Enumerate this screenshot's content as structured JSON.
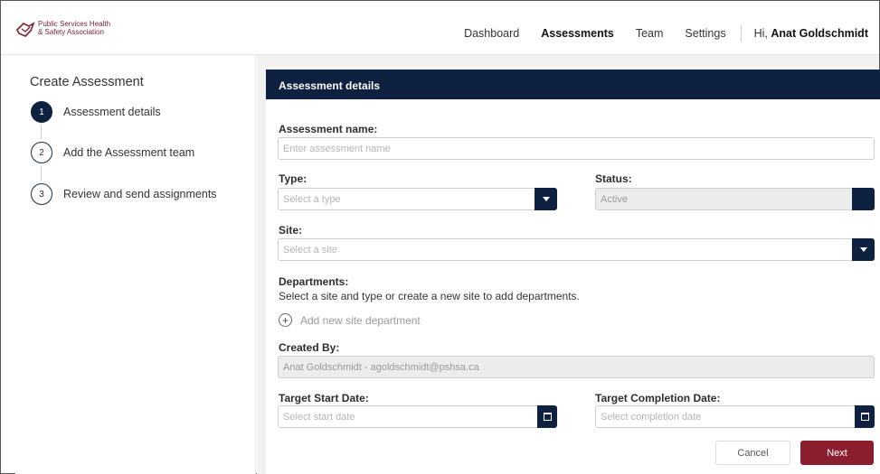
{
  "header": {
    "logo_line1": "Public Services Health",
    "logo_line2": "& Safety Association",
    "nav": [
      "Dashboard",
      "Assessments",
      "Team",
      "Settings"
    ],
    "active_nav": "Assessments",
    "greeting_prefix": "Hi,",
    "user_name": "Anat Goldschmidt"
  },
  "sidebar": {
    "title": "Create Assessment",
    "steps": [
      {
        "num": "1",
        "label": "Assessment details"
      },
      {
        "num": "2",
        "label": "Add the Assessment team"
      },
      {
        "num": "3",
        "label": "Review and send assignments"
      }
    ]
  },
  "form": {
    "header": "Assessment details",
    "name_label": "Assessment name:",
    "name_placeholder": "Enter assessment name",
    "type_label": "Type:",
    "type_placeholder": "Select a type",
    "status_label": "Status:",
    "status_value": "Active",
    "site_label": "Site:",
    "site_placeholder": "Select a site",
    "departments_label": "Departments:",
    "departments_hint": "Select a site and type or create a new site to add departments.",
    "add_department": "Add new site department",
    "created_by_label": "Created By:",
    "created_by_value": "Anat Goldschmidt - agoldschmidt@pshsa.ca",
    "start_label": "Target Start Date:",
    "start_placeholder": "Select start date",
    "completion_label": "Target Completion Date:",
    "completion_placeholder": "Select completion date",
    "cancel_label": "Cancel",
    "next_label": "Next"
  },
  "colors": {
    "navy": "#0f2140",
    "brand": "#8a1e2e"
  }
}
